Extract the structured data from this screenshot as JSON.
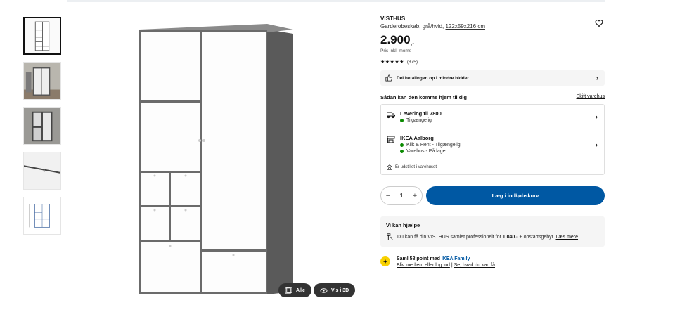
{
  "product": {
    "brand": "VISTHUS",
    "description": "Garderobeskab, grå/hvid,",
    "size_link": "122x59x216 cm",
    "price": "2.900",
    "price_suffix": ",-",
    "vat_note": "Pris inkl. moms",
    "rating_stars": "★★★★★",
    "rating_value": 4.5,
    "review_count": "(875)"
  },
  "payment": {
    "label": "Del betalingen op i mindre bidder"
  },
  "delivery": {
    "heading": "Sådan kan den komme hjem til dig",
    "change_store": "Skift varehus",
    "home": {
      "title": "Levering til 7800",
      "status": "Tilgængelig"
    },
    "store": {
      "title": "IKEA Aalborg",
      "line1": "Klik & Hent - Tilgængelig",
      "line2": "Varehus - På lager"
    },
    "exhibited": "Er udstillet i varehuset"
  },
  "cart": {
    "quantity": "1",
    "minus": "−",
    "plus": "+",
    "button_label": "Læg i indkøbskurv"
  },
  "help": {
    "heading": "Vi kan hjælpe",
    "text_pre": "Du kan få din VISTHUS samlet professionelt for",
    "price": "1.040.-",
    "text_post": "+ opstartsgebyr.",
    "link": "Læs mere"
  },
  "family": {
    "text_pre": "Saml 58 point med",
    "brand": "IKEA Family",
    "link1": "Bliv medlem eller log ind",
    "separator": "|",
    "link2": "Se, hvad du kan få"
  },
  "gallery": {
    "all_label": "Alle",
    "view3d_label": "Vis i 3D"
  },
  "colors": {
    "accent": "#0058a3",
    "available": "#0a8a00",
    "family": "#f8d100"
  }
}
